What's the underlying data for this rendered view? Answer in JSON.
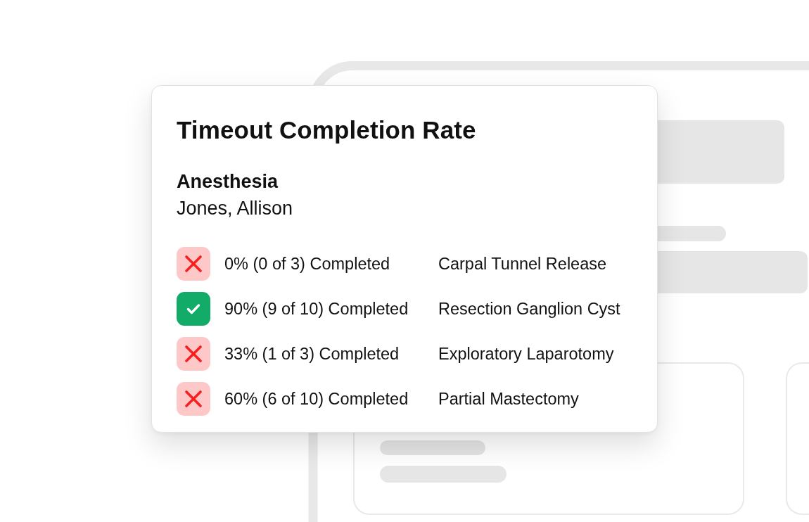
{
  "card": {
    "title": "Timeout Completion Rate",
    "department": "Anesthesia",
    "person": "Jones, Allison",
    "procedures": [
      {
        "kind": "missed",
        "completion": "0% (0 of 3) Completed",
        "name": "Carpal Tunnel Release"
      },
      {
        "kind": "met",
        "completion": "90% (9 of 10) Completed",
        "name": "Resection Ganglion Cyst"
      },
      {
        "kind": "missed",
        "completion": "33% (1 of 3) Completed",
        "name": "Exploratory Laparotomy"
      },
      {
        "kind": "missed",
        "completion": "60% (6 of 10) Completed",
        "name": "Partial Mastectomy"
      }
    ]
  }
}
